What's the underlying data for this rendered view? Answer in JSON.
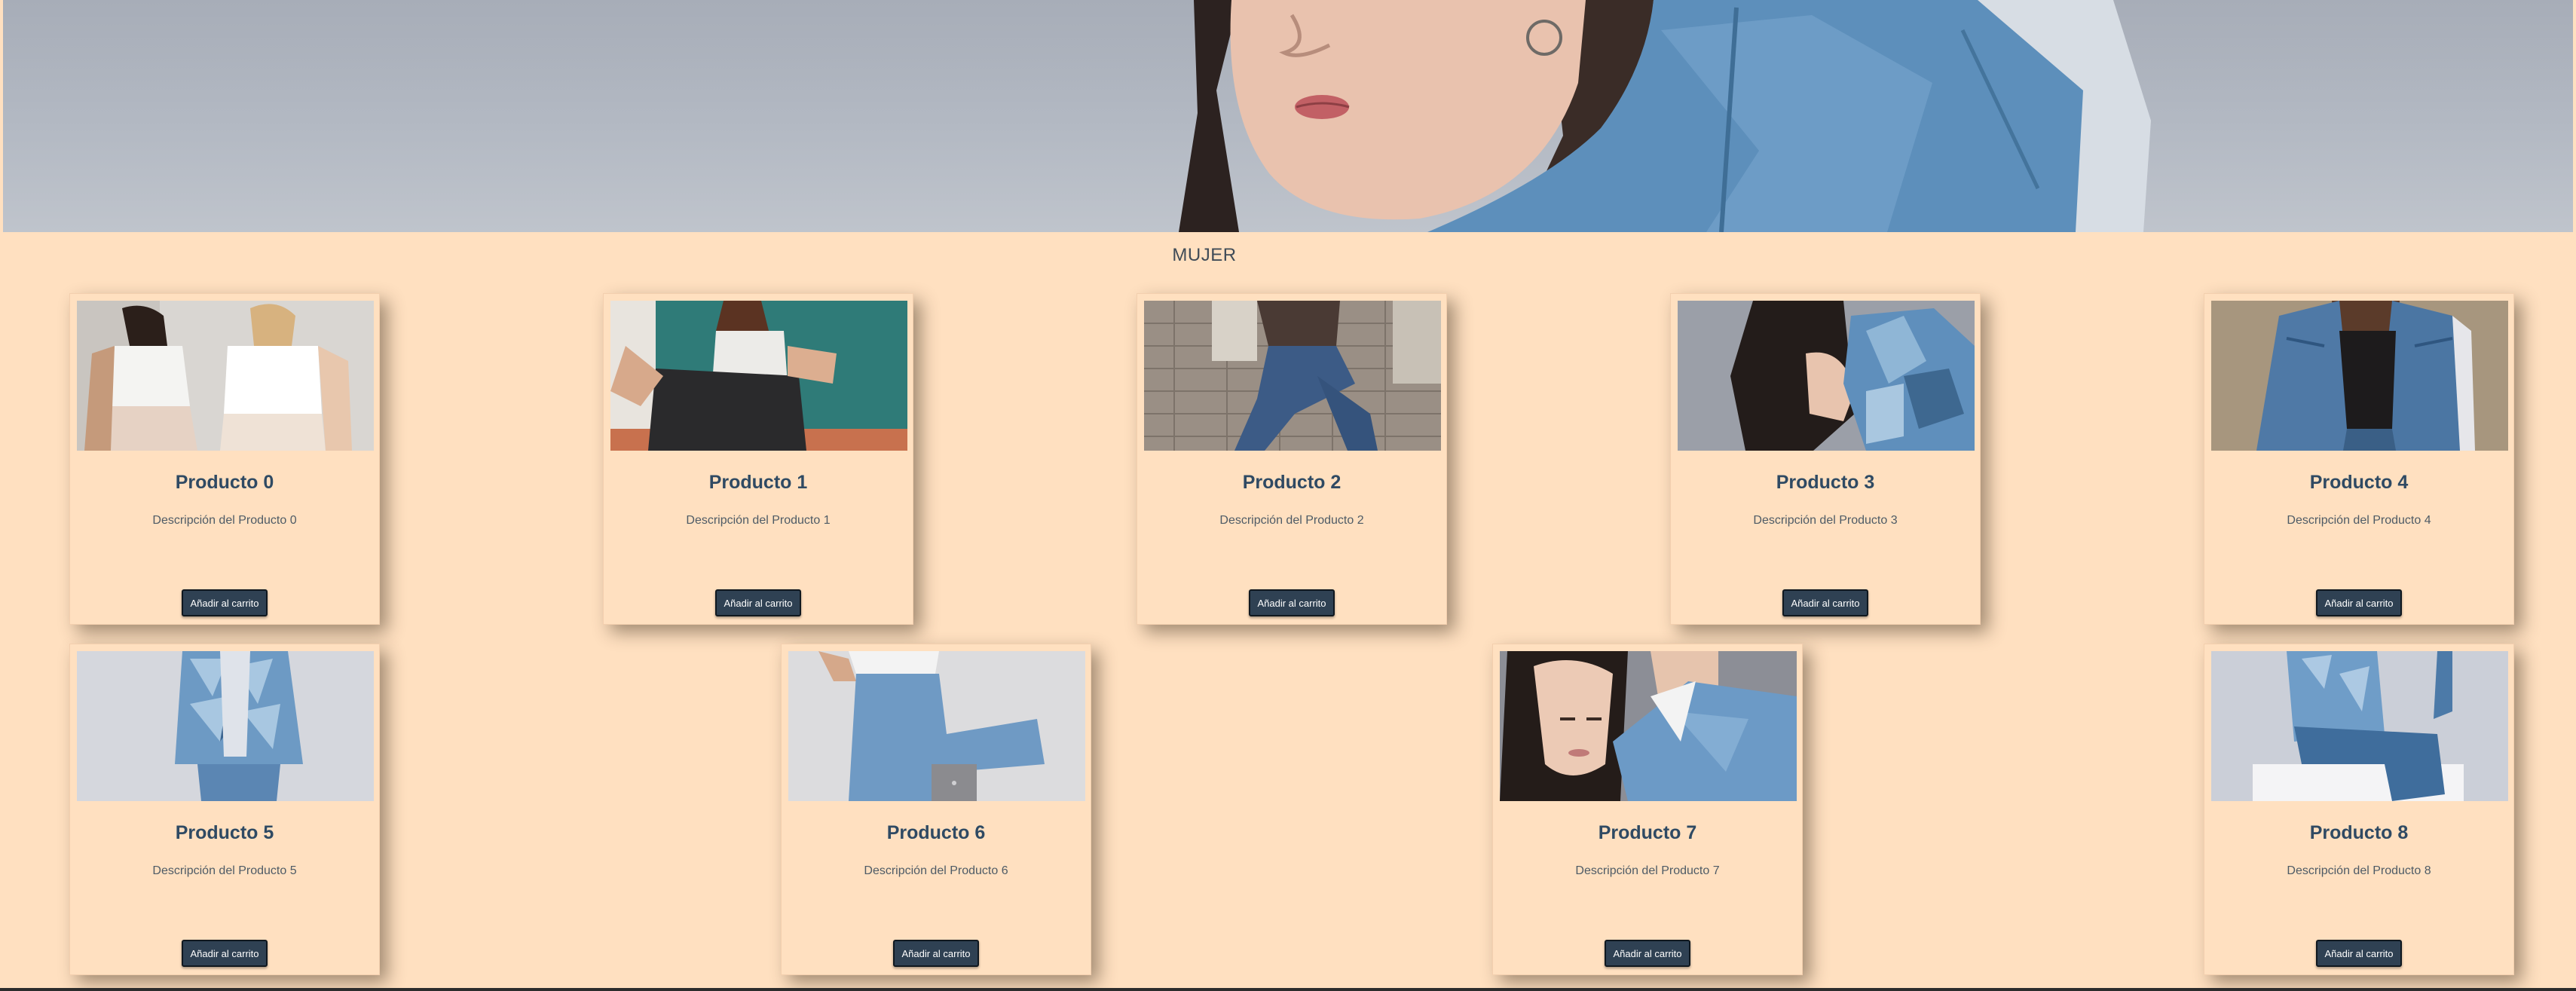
{
  "section": {
    "title": "MUJER"
  },
  "products": [
    {
      "name": "Producto 0",
      "description": "Descripción del Producto 0",
      "button": "Añadir al carrito"
    },
    {
      "name": "Producto 1",
      "description": "Descripción del Producto 1",
      "button": "Añadir al carrito"
    },
    {
      "name": "Producto 2",
      "description": "Descripción del Producto 2",
      "button": "Añadir al carrito"
    },
    {
      "name": "Producto 3",
      "description": "Descripción del Producto 3",
      "button": "Añadir al carrito"
    },
    {
      "name": "Producto 4",
      "description": "Descripción del Producto 4",
      "button": "Añadir al carrito"
    },
    {
      "name": "Producto 5",
      "description": "Descripción del Producto 5",
      "button": "Añadir al carrito"
    },
    {
      "name": "Producto 6",
      "description": "Descripción del Producto 6",
      "button": "Añadir al carrito"
    },
    {
      "name": "Producto 7",
      "description": "Descripción del Producto 7",
      "button": "Añadir al carrito"
    },
    {
      "name": "Producto 8",
      "description": "Descripción del Producto 8",
      "button": "Añadir al carrito"
    }
  ],
  "colors": {
    "background": "#ffe0c0",
    "title": "#2f4a63",
    "button": "#2f4153",
    "denim": "#5b8cb8"
  }
}
